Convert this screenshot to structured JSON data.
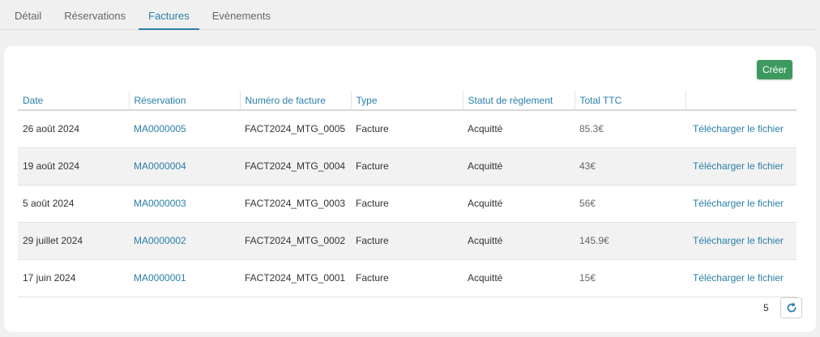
{
  "tabs": [
    {
      "label": "Détail",
      "active": false
    },
    {
      "label": "Réservations",
      "active": false
    },
    {
      "label": "Factures",
      "active": true
    },
    {
      "label": "Evènements",
      "active": false
    }
  ],
  "create_label": "Créer",
  "table": {
    "columns": [
      "Date",
      "Réservation",
      "Numéro de facture",
      "Type",
      "Statut de règlement",
      "Total TTC",
      ""
    ],
    "rows": [
      {
        "date": "26 août 2024",
        "reservation": "MA0000005",
        "invoice": "FACT2024_MTG_0005",
        "type": "Facture",
        "status": "Acquitté",
        "total": "85.3€",
        "download": "Télécharger le fichier"
      },
      {
        "date": "19 août 2024",
        "reservation": "MA0000004",
        "invoice": "FACT2024_MTG_0004",
        "type": "Facture",
        "status": "Acquitté",
        "total": "43€",
        "download": "Télécharger le fichier"
      },
      {
        "date": "5 août 2024",
        "reservation": "MA0000003",
        "invoice": "FACT2024_MTG_0003",
        "type": "Facture",
        "status": "Acquitté",
        "total": "56€",
        "download": "Télécharger le fichier"
      },
      {
        "date": "29 juillet 2024",
        "reservation": "MA0000002",
        "invoice": "FACT2024_MTG_0002",
        "type": "Facture",
        "status": "Acquitté",
        "total": "145.9€",
        "download": "Télécharger le fichier"
      },
      {
        "date": "17 juin 2024",
        "reservation": "MA0000001",
        "invoice": "FACT2024_MTG_0001",
        "type": "Facture",
        "status": "Acquitté",
        "total": "15€",
        "download": "Télécharger le fichier"
      }
    ]
  },
  "footer": {
    "count": "5",
    "refresh_icon": "refresh-icon"
  },
  "colors": {
    "accent": "#2a7fa8",
    "create_button": "#3d9a5f"
  }
}
